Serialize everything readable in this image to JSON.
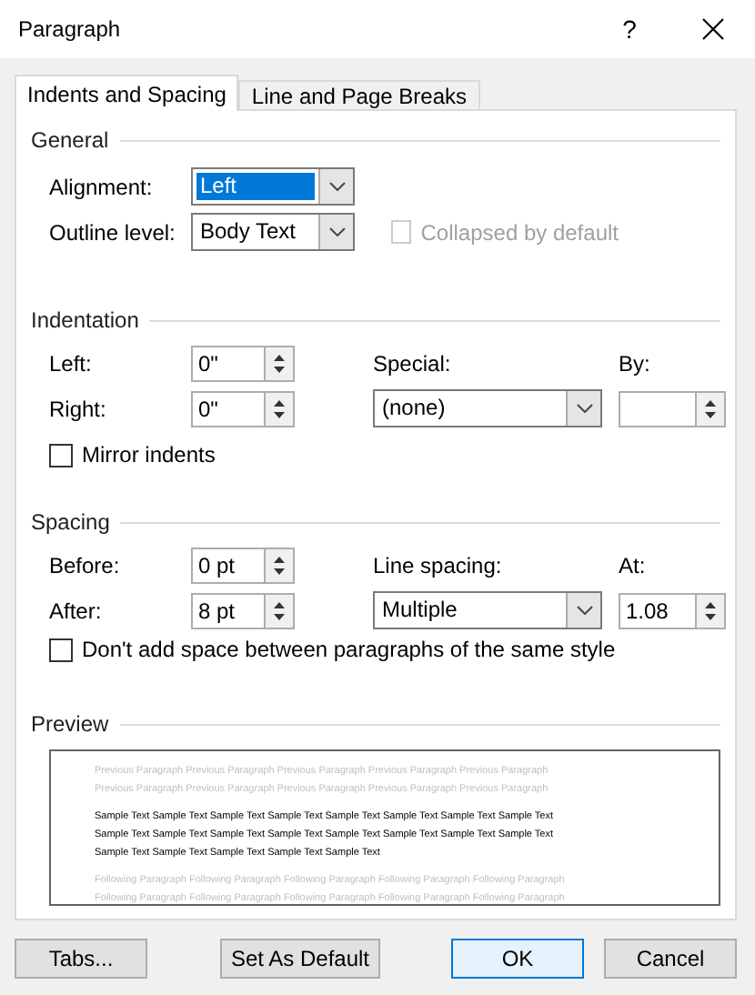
{
  "window": {
    "title": "Paragraph",
    "help": "?"
  },
  "tabs": [
    {
      "label": "Indents and Spacing",
      "selected": true
    },
    {
      "label": "Line and Page Breaks",
      "selected": false
    }
  ],
  "general": {
    "heading": "General",
    "alignment": {
      "label": "Alignment:",
      "value": "Left",
      "highlighted": true
    },
    "outline_level": {
      "label": "Outline level:",
      "value": "Body Text",
      "highlighted": false
    },
    "collapsed": {
      "label": "Collapsed by default",
      "checked": false,
      "disabled": true
    }
  },
  "indentation": {
    "heading": "Indentation",
    "left": {
      "label": "Left:",
      "value": "0\""
    },
    "right": {
      "label": "Right:",
      "value": "0\""
    },
    "special": {
      "label": "Special:",
      "value": "(none)"
    },
    "by": {
      "label": "By:"
    },
    "mirror": {
      "label": "Mirror indents",
      "checked": false,
      "disabled": false
    }
  },
  "spacing": {
    "heading": "Spacing",
    "before": {
      "label": "Before:",
      "value": "0 pt"
    },
    "after": {
      "label": "After:",
      "value": "8 pt"
    },
    "line_spacing": {
      "label": "Line spacing:",
      "value": "Multiple"
    },
    "at": {
      "label": "At:",
      "value": "1.08"
    },
    "dont_add": {
      "label": "Don't add space between paragraphs of the same style",
      "checked": false,
      "disabled": false
    }
  },
  "preview": {
    "heading": "Preview",
    "previous": [
      "Previous Paragraph Previous Paragraph Previous Paragraph Previous Paragraph Previous Paragraph",
      "Previous Paragraph Previous Paragraph Previous Paragraph Previous Paragraph Previous Paragraph"
    ],
    "sample": [
      "Sample Text Sample Text Sample Text Sample Text Sample Text Sample Text Sample Text Sample Text",
      "Sample Text Sample Text Sample Text Sample Text Sample Text Sample Text Sample Text Sample Text",
      "Sample Text Sample Text Sample Text Sample Text Sample Text"
    ],
    "following": [
      "Following Paragraph Following Paragraph Following Paragraph Following Paragraph Following Paragraph",
      "Following Paragraph Following Paragraph Following Paragraph Following Paragraph Following Paragraph"
    ]
  },
  "buttons": [
    {
      "label": "Tabs...",
      "kind": "plain"
    },
    {
      "label": "Set As Default",
      "kind": "plain"
    },
    {
      "label": "OK",
      "kind": "default"
    },
    {
      "label": "Cancel",
      "kind": "plain"
    }
  ]
}
